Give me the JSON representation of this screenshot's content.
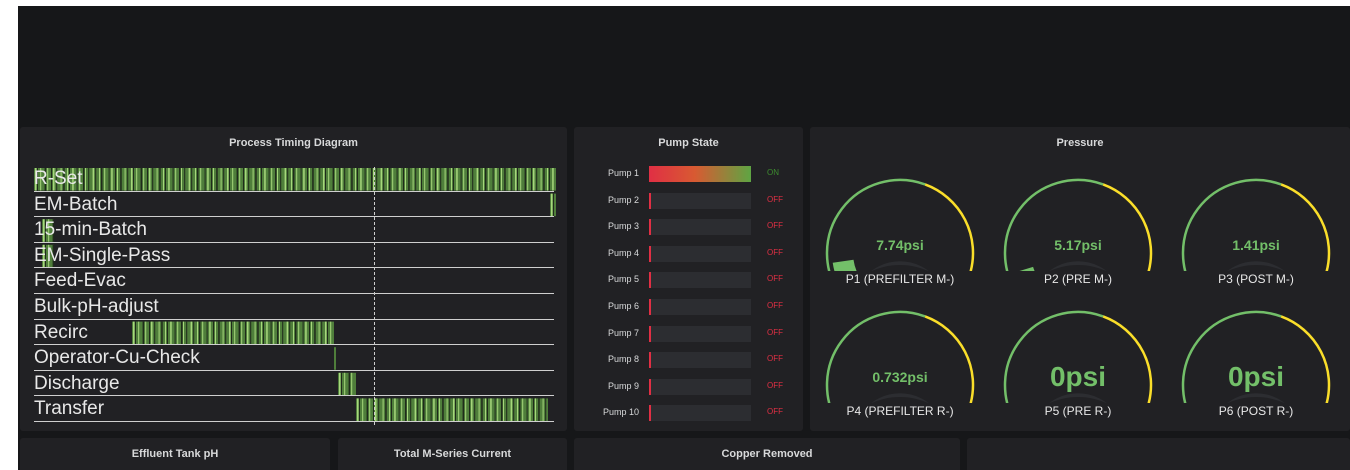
{
  "panels": {
    "timing": {
      "title": "Process Timing Diagram"
    },
    "pumps": {
      "title": "Pump State"
    },
    "pressure": {
      "title": "Pressure"
    },
    "ph": {
      "title": "Effluent Tank pH"
    },
    "current": {
      "title": "Total M-Series Current"
    },
    "copper": {
      "title": "Copper Removed"
    },
    "blank": {
      "title": ""
    }
  },
  "timing": {
    "lanes": [
      "R-Set",
      "EM-Batch",
      "15-min-Batch",
      "EM-Single-Pass",
      "Feed-Evac",
      "Bulk-pH-adjust",
      "Recirc",
      "Operator-Cu-Check",
      "Discharge",
      "Transfer"
    ]
  },
  "pumps": [
    {
      "label": "Pump 1",
      "state": "ON",
      "level": 1.0
    },
    {
      "label": "Pump 2",
      "state": "OFF",
      "level": 0
    },
    {
      "label": "Pump 3",
      "state": "OFF",
      "level": 0
    },
    {
      "label": "Pump 4",
      "state": "OFF",
      "level": 0
    },
    {
      "label": "Pump 5",
      "state": "OFF",
      "level": 0
    },
    {
      "label": "Pump 6",
      "state": "OFF",
      "level": 0
    },
    {
      "label": "Pump 7",
      "state": "OFF",
      "level": 0
    },
    {
      "label": "Pump 8",
      "state": "OFF",
      "level": 0
    },
    {
      "label": "Pump 9",
      "state": "OFF",
      "level": 0
    },
    {
      "label": "Pump 10",
      "state": "OFF",
      "level": 0
    }
  ],
  "gauges": [
    {
      "label": "P1 (PREFILTER M-)",
      "value": "7.74psi",
      "level": 0.11
    },
    {
      "label": "P2 (PRE M-)",
      "value": "5.17psi",
      "level": 0.075
    },
    {
      "label": "P3 (POST M-)",
      "value": "1.41psi",
      "level": 0.025
    },
    {
      "label": "P4 (PREFILTER R-)",
      "value": "0.732psi",
      "level": 0.012
    },
    {
      "label": "P5 (PRE R-)",
      "value": "0psi",
      "level": 0
    },
    {
      "label": "P6 (POST R-)",
      "value": "0psi",
      "level": 0
    }
  ],
  "colors": {
    "green": "#73bf69",
    "yellow": "#fade2a",
    "red": "#f2495c",
    "off": "#e02f44",
    "on": "#3d8c2f"
  }
}
